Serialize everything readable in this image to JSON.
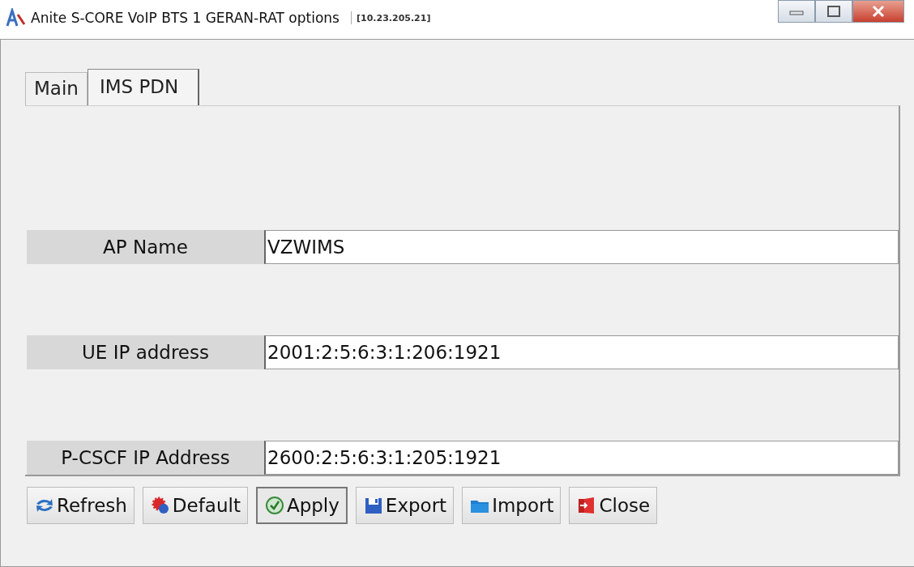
{
  "window": {
    "title": "Anite S-CORE VoIP BTS 1 GERAN-RAT options",
    "address": "[10.23.205.21]"
  },
  "tabs": [
    {
      "label": "Main",
      "selected": false
    },
    {
      "label": "IMS PDN",
      "selected": true
    }
  ],
  "fields": [
    {
      "label": "AP Name",
      "value": "VZWIMS"
    },
    {
      "label": "UE IP address",
      "value": "2001:2:5:6:3:1:206:1921"
    },
    {
      "label": "P-CSCF IP Address",
      "value": "2600:2:5:6:3:1:205:1921"
    }
  ],
  "buttons": [
    {
      "label": "Refresh",
      "kind": "refresh",
      "focused": false
    },
    {
      "label": "Default",
      "kind": "default",
      "focused": false
    },
    {
      "label": "Apply",
      "kind": "apply",
      "focused": true
    },
    {
      "label": "Export",
      "kind": "export",
      "focused": false
    },
    {
      "label": "Import",
      "kind": "import",
      "focused": false
    },
    {
      "label": "Close",
      "kind": "close",
      "focused": false
    }
  ]
}
